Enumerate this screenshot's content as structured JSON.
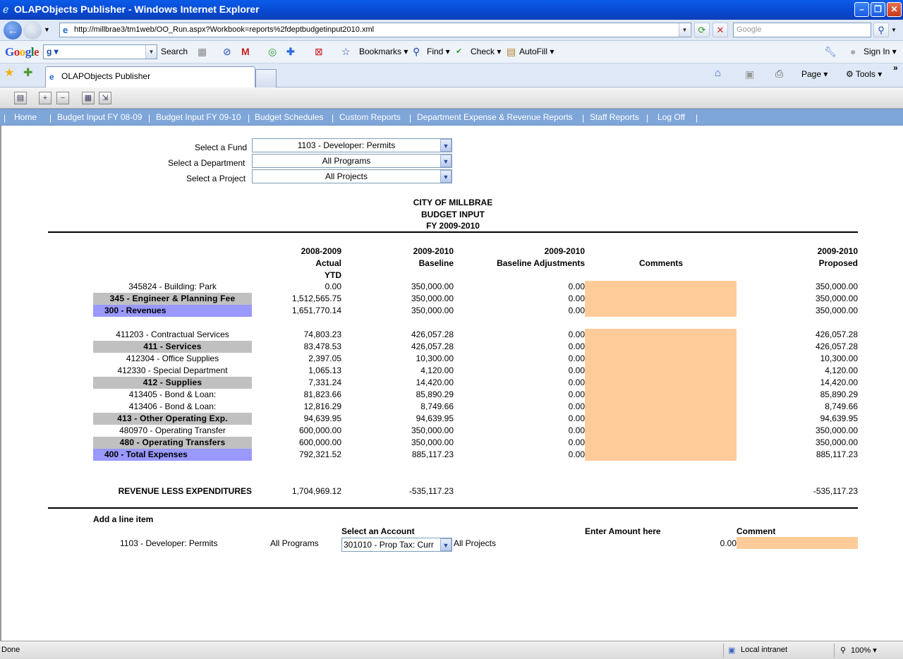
{
  "window": {
    "title": "OLAPObjects Publisher - Windows Internet Explorer"
  },
  "address": {
    "url": "http://millbrae3/tm1web/OO_Run.aspx?Workbook=reports%2fdeptbudgetinput2010.xml"
  },
  "search": {
    "placeholder": "Google"
  },
  "google_toolbar": {
    "logo": "Google",
    "search_box": "g",
    "search_label": "Search",
    "bookmarks": "Bookmarks",
    "find": "Find",
    "check": "Check",
    "autofill": "AutoFill",
    "sign_in": "Sign In"
  },
  "tabs": {
    "active": "OLAPObjects Publisher",
    "page": "Page",
    "tools": "Tools"
  },
  "menu": {
    "items": [
      "Home",
      "Budget Input FY 08-09",
      "Budget Input FY 09-10",
      "Budget Schedules",
      "Custom Reports",
      "Department Expense & Revenue Reports",
      "Staff Reports",
      "Log Off"
    ]
  },
  "filters": {
    "fund_label": "Select a Fund",
    "fund_value": "1103 - Developer: Permits",
    "dept_label": "Select a Department",
    "dept_value": "All Programs",
    "project_label": "Select a Project",
    "project_value": "All Projects"
  },
  "report": {
    "title1": "CITY OF MILLBRAE",
    "title2": "BUDGET INPUT",
    "title3": "FY 2009-2010",
    "col1": [
      "2008-2009",
      "Actual",
      "YTD"
    ],
    "col2": [
      "2009-2010",
      "Baseline"
    ],
    "col3": [
      "2009-2010",
      "Baseline Adjustments"
    ],
    "col_comments": "Comments",
    "col4": [
      "2009-2010",
      "Proposed"
    ],
    "rows": [
      {
        "name": "345824 - Building: Park",
        "actual": "0.00",
        "baseline": "350,000.00",
        "adj": "0.00",
        "proposed": "350,000.00"
      },
      {
        "name": "345 - Engineer & Planning Fee",
        "actual": "1,512,565.75",
        "baseline": "350,000.00",
        "adj": "0.00",
        "proposed": "350,000.00"
      },
      {
        "name": "300 - Revenues",
        "actual": "1,651,770.14",
        "baseline": "350,000.00",
        "adj": "0.00",
        "proposed": "350,000.00"
      },
      {
        "name": "411203 - Contractual Services",
        "actual": "74,803.23",
        "baseline": "426,057.28",
        "adj": "0.00",
        "proposed": "426,057.28"
      },
      {
        "name": "411 - Services",
        "actual": "83,478.53",
        "baseline": "426,057.28",
        "adj": "0.00",
        "proposed": "426,057.28"
      },
      {
        "name": "412304 - Office Supplies",
        "actual": "2,397.05",
        "baseline": "10,300.00",
        "adj": "0.00",
        "proposed": "10,300.00"
      },
      {
        "name": "412330 - Special Department",
        "actual": "1,065.13",
        "baseline": "4,120.00",
        "adj": "0.00",
        "proposed": "4,120.00"
      },
      {
        "name": "412 - Supplies",
        "actual": "7,331.24",
        "baseline": "14,420.00",
        "adj": "0.00",
        "proposed": "14,420.00"
      },
      {
        "name": "413405 - Bond & Loan:",
        "actual": "81,823.66",
        "baseline": "85,890.29",
        "adj": "0.00",
        "proposed": "85,890.29"
      },
      {
        "name": "413406 - Bond & Loan:",
        "actual": "12,816.29",
        "baseline": "8,749.66",
        "adj": "0.00",
        "proposed": "8,749.66"
      },
      {
        "name": "413 - Other Operating Exp.",
        "actual": "94,639.95",
        "baseline": "94,639.95",
        "adj": "0.00",
        "proposed": "94,639.95"
      },
      {
        "name": "480970 - Operating Transfer",
        "actual": "600,000.00",
        "baseline": "350,000.00",
        "adj": "0.00",
        "proposed": "350,000.00"
      },
      {
        "name": "480 - Operating Transfers",
        "actual": "600,000.00",
        "baseline": "350,000.00",
        "adj": "0.00",
        "proposed": "350,000.00"
      },
      {
        "name": "400 - Total Expenses",
        "actual": "792,321.52",
        "baseline": "885,117.23",
        "adj": "0.00",
        "proposed": "885,117.23"
      }
    ],
    "summary": {
      "label": "REVENUE LESS EXPENDITURES",
      "actual": "1,704,969.12",
      "baseline": "-535,117.23",
      "proposed": "-535,117.23"
    }
  },
  "add_line": {
    "title": "Add a line item",
    "account_label": "Select an Account",
    "amount_label": "Enter Amount here",
    "comment_label": "Comment",
    "fund": "1103 - Developer: Permits",
    "program": "All Programs",
    "account_value": "301010 - Prop Tax: Curr",
    "project": "All Projects",
    "amount": "0.00"
  },
  "status": {
    "text": "Done",
    "zone": "Local intranet",
    "zoom": "100%"
  }
}
